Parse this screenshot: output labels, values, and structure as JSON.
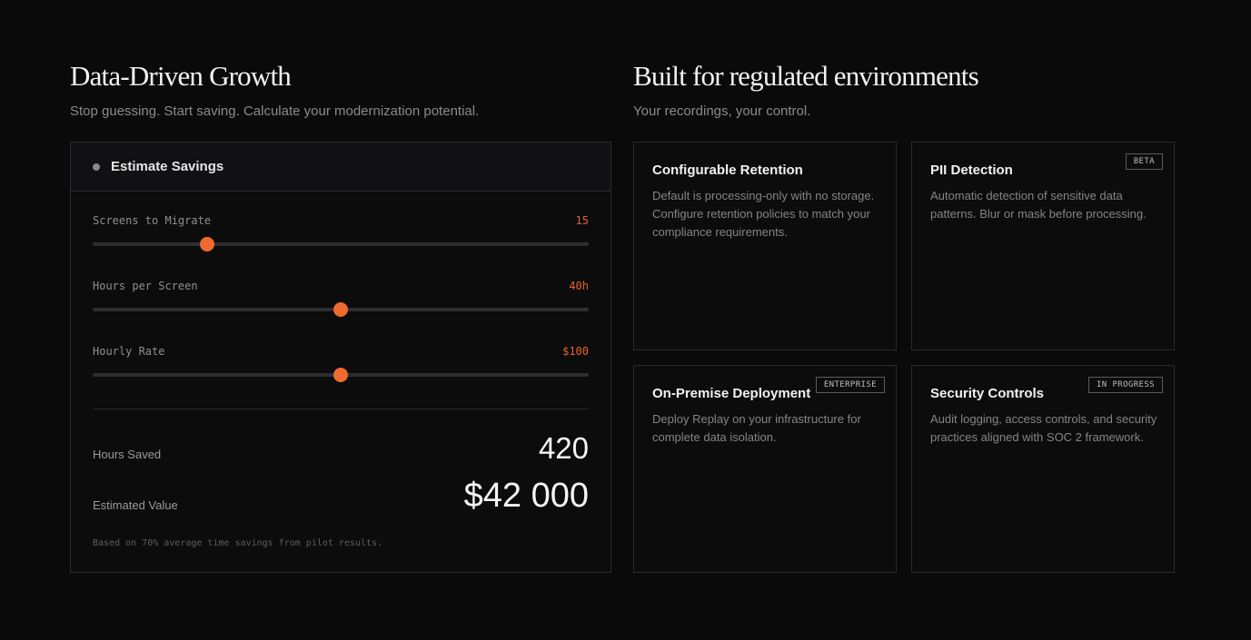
{
  "left_section": {
    "heading": "Data-Driven Growth",
    "subtitle": "Stop guessing. Start saving. Calculate your modernization potential."
  },
  "right_section": {
    "heading": "Built for regulated environments",
    "subtitle": "Your recordings, your control."
  },
  "calculator": {
    "title": "Estimate Savings",
    "sliders": [
      {
        "label": "Screens to Migrate",
        "value": "15",
        "fraction": 0.23
      },
      {
        "label": "Hours per Screen",
        "value": "40h",
        "fraction": 0.5
      },
      {
        "label": "Hourly Rate",
        "value": "$100",
        "fraction": 0.5
      }
    ],
    "results": {
      "hours_label": "Hours Saved",
      "hours_value": "420",
      "value_label": "Estimated Value",
      "value_value": "$42 000"
    },
    "footnote": "Based on 70% average time savings from pilot results."
  },
  "features": [
    {
      "title": "Configurable Retention",
      "desc": "Default is processing-only with no storage. Configure retention policies to match your compliance requirements.",
      "badge": ""
    },
    {
      "title": "PII Detection",
      "desc": "Automatic detection of sensitive data patterns. Blur or mask before processing.",
      "badge": "BETA"
    },
    {
      "title": "On-Premise Deployment",
      "desc": "Deploy Replay on your infrastructure for complete data isolation.",
      "badge": "ENTERPRISE"
    },
    {
      "title": "Security Controls",
      "desc": "Audit logging, access controls, and security practices aligned with SOC 2 framework.",
      "badge": "IN PROGRESS"
    }
  ],
  "colors": {
    "accent": "#ee6a2e",
    "background": "#0a0a0b"
  }
}
